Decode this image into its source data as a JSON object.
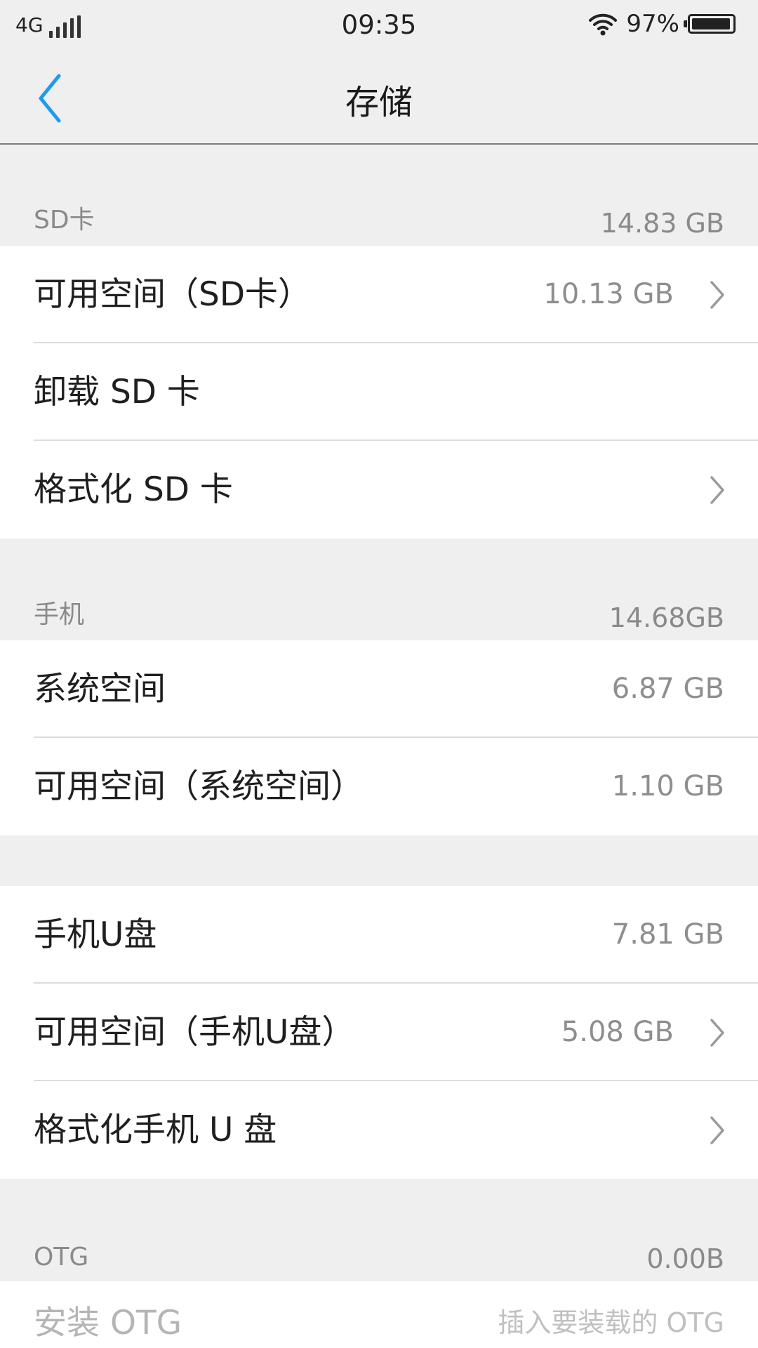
{
  "status_bar": {
    "network": "4G",
    "time": "09:35",
    "battery": "97%",
    "battery_level": 0.97
  },
  "nav": {
    "title": "存储",
    "back_icon": "chevron-left-icon",
    "accent_color": "#1e9af0"
  },
  "sd_section": {
    "header": "SD卡",
    "total": "14.83 GB",
    "items": [
      {
        "label": "可用空间（SD卡）",
        "value": "10.13 GB"
      },
      {
        "label": "卸载 SD 卡"
      },
      {
        "label": "格式化 SD 卡"
      }
    ]
  },
  "phone_section": {
    "header": "手机",
    "total": "14.68GB",
    "items": [
      {
        "label": "系统空间",
        "value": "6.87 GB"
      },
      {
        "label": "可用空间（系统空间）",
        "value": "1.10 GB"
      }
    ]
  },
  "udisk_section": {
    "items": [
      {
        "label": "手机U盘",
        "value": "7.81 GB"
      },
      {
        "label": "可用空间（手机U盘）",
        "value": "5.08 GB"
      },
      {
        "label": "格式化手机 U 盘"
      }
    ]
  },
  "otg_section": {
    "header": "OTG",
    "total": "0.00B",
    "items": [
      {
        "label": "安装 OTG",
        "value": "插入要装载的 OTG"
      }
    ]
  }
}
